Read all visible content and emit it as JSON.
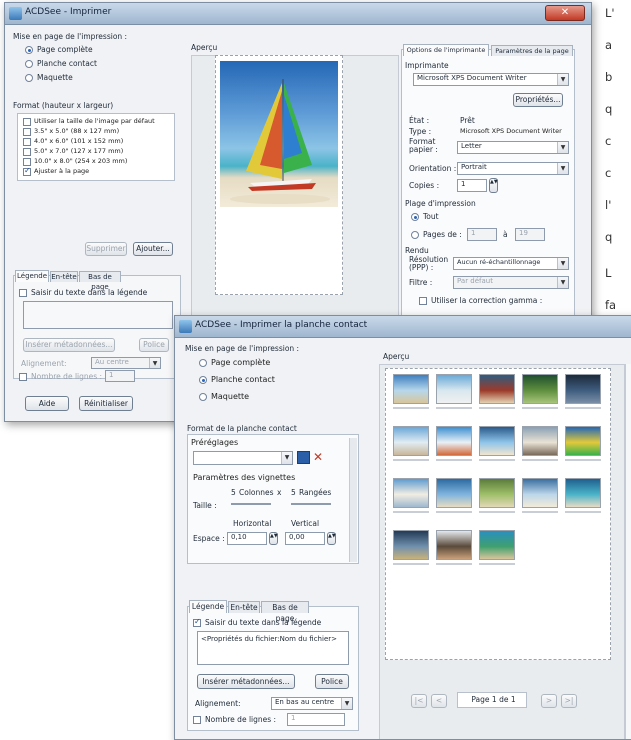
{
  "side_text": [
    "L'",
    "a",
    "b",
    "q",
    "c",
    "c",
    "l'",
    "q",
    "L",
    "fa"
  ],
  "w1": {
    "title": "ACDSee - Imprimer",
    "layout_label": "Mise en page de l'impression :",
    "layout_options": [
      "Page complète",
      "Planche contact",
      "Maquette"
    ],
    "layout_selected": 0,
    "apercu": "Aperçu",
    "format_label": "Format (hauteur x largeur)",
    "formats": [
      {
        "label": "Utiliser la taille de l'image par défaut",
        "checked": false
      },
      {
        "label": "3.5\" x 5.0\" (88 x 127 mm)",
        "checked": false
      },
      {
        "label": "4.0\" x 6.0\" (101 x 152 mm)",
        "checked": false
      },
      {
        "label": "5.0\" x 7.0\" (127 x 177 mm)",
        "checked": false
      },
      {
        "label": "10.0\" x 8.0\" (254 x 203 mm)",
        "checked": false
      },
      {
        "label": "Ajuster à la page",
        "checked": true
      }
    ],
    "supprimer": "Supprimer",
    "ajouter": "Ajouter...",
    "caption_tabs": [
      "Légende",
      "En-tête",
      "Bas de page"
    ],
    "saisir": "Saisir du texte dans la légende",
    "inserer": "Insérer métadonnées...",
    "police": "Police",
    "alignement": "Alignement:",
    "align_value": "Au centre",
    "nombre_lignes": "Nombre de lignes :",
    "nombre_value": "1",
    "aide": "Aide",
    "reinitialiser": "Réinitialiser",
    "options_tabs": [
      "Options de l'imprimante",
      "Paramètres de la page"
    ],
    "imprimante_label": "Imprimante",
    "printer": "Microsoft XPS Document Writer",
    "proprietes": "Propriétés...",
    "etat_label": "État :",
    "etat_value": "Prêt",
    "type_label": "Type :",
    "type_value": "Microsoft XPS Document Writer",
    "format_papier_label": "Format papier :",
    "format_papier_value": "Letter",
    "orientation_label": "Orientation :",
    "orientation_value": "Portrait",
    "copies_label": "Copies :",
    "copies_value": "1",
    "plage_label": "Plage d'impression",
    "tout": "Tout",
    "pages_de": "Pages de :",
    "pages_from": "1",
    "pages_a": "à",
    "pages_to": "19",
    "rendu_label": "Rendu",
    "resolution_label": "Résolution (PPP) :",
    "resolution_value": "Aucun ré-échantillonnage",
    "filtre_label": "Filtre :",
    "filtre_value": "Par défaut",
    "gamma": "Utiliser la correction gamma :"
  },
  "w2": {
    "title": "ACDSee - Imprimer la planche contact",
    "layout_label": "Mise en page de l'impression :",
    "layout_options": [
      "Page complète",
      "Planche contact",
      "Maquette"
    ],
    "layout_selected": 1,
    "apercu": "Aperçu",
    "format_label": "Format de la planche contact",
    "preglages": "Préréglages",
    "params_vignettes": "Paramètres des vignettes",
    "cols_value": "5",
    "cols_label": "Colonnes",
    "times": "x",
    "rows_value": "5",
    "rows_label": "Rangées",
    "taille": "Taille :",
    "horizontal": "Horizontal",
    "vertical": "Vertical",
    "espace": "Espace :",
    "h_value": "0,10",
    "v_value": "0,00",
    "caption_tabs": [
      "Légende",
      "En-tête",
      "Bas de page"
    ],
    "saisir": "Saisir du texte dans la légende",
    "caption_text": "<Propriétés du fichier:Nom du fichier>",
    "inserer": "Insérer métadonnées...",
    "police": "Police",
    "alignement": "Alignement:",
    "align_value": "En bas au centre",
    "nombre_lignes": "Nombre de lignes :",
    "nombre_value": "1",
    "page_indicator": "Page 1 de 1"
  },
  "colors": {
    "titlebar": "#b3c7dd",
    "close": "#c9452f",
    "selection": "#2a63b8"
  }
}
